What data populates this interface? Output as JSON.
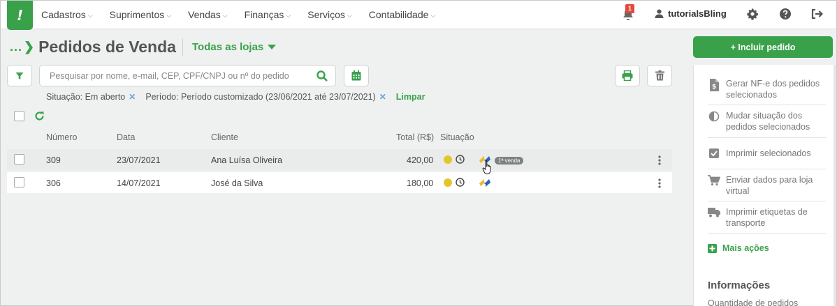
{
  "app": {
    "logo_glyph": "!",
    "brand_color": "#3aa14b"
  },
  "topnav": {
    "items": [
      {
        "label": "Cadastros"
      },
      {
        "label": "Suprimentos"
      },
      {
        "label": "Vendas"
      },
      {
        "label": "Finanças"
      },
      {
        "label": "Serviços"
      },
      {
        "label": "Contabilidade"
      }
    ],
    "notifications_count": "1",
    "username": "tutorialsBling"
  },
  "header": {
    "breadcrumb_dots": "...",
    "title": "Pedidos de Venda",
    "store_selector": "Todas as lojas"
  },
  "search": {
    "placeholder": "Pesquisar por nome, e-mail, CEP, CPF/CNPJ ou nº do pedido",
    "value": ""
  },
  "filters": {
    "situation": "Situação: Em aberto",
    "period": "Período: Período customizado (23/06/2021 até 23/07/2021)",
    "clear_label": "Limpar"
  },
  "table": {
    "columns": [
      "Número",
      "Data",
      "Cliente",
      "Total (R$)",
      "Situação"
    ],
    "rows": [
      {
        "number": "309",
        "date": "23/07/2021",
        "client": "Ana Luísa Oliveira",
        "total": "420,00",
        "status_color": "#e7c52a",
        "tag": "1ª venda"
      },
      {
        "number": "306",
        "date": "14/07/2021",
        "client": "José da Silva",
        "total": "180,00",
        "status_color": "#e7c52a",
        "tag": ""
      }
    ]
  },
  "side": {
    "include_button": "+ Incluir pedido",
    "actions": [
      {
        "label": "Gerar NF-e dos pedidos selecionados",
        "icon": "invoice-icon"
      },
      {
        "label": "Mudar situação dos pedidos selecionados",
        "icon": "half-circle-icon"
      },
      {
        "label": "Imprimir selecionados",
        "icon": "checkbox-icon"
      },
      {
        "label": "Enviar dados para loja virtual",
        "icon": "cart-icon"
      },
      {
        "label": "Imprimir etiquetas de transporte",
        "icon": "truck-icon"
      }
    ],
    "more_actions": "Mais ações",
    "info_title": "Informações",
    "info_sub": "Quantidade de pedidos"
  }
}
